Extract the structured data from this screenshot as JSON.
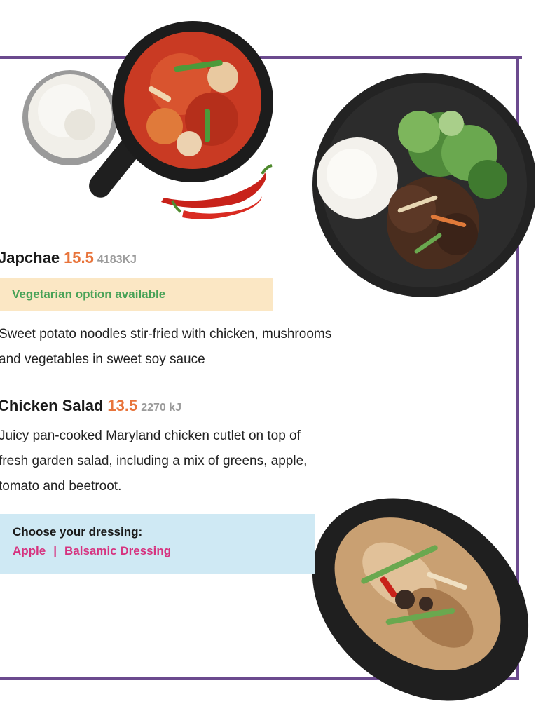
{
  "colors": {
    "frame": "#6b4a8e",
    "price": "#e8743b",
    "energy": "#9a9a9a",
    "veg_badge_bg": "#fbe7c4",
    "veg_text": "#48a257",
    "dressing_bg": "#cfe9f4",
    "dressing_option": "#d6337f"
  },
  "menu": {
    "japchae": {
      "name": "Japchae",
      "price": "15.5",
      "energy": "4183KJ",
      "badge": "Vegetarian option available",
      "description_lines": [
        "Sweet potato noodles stir-fried with chicken, mushrooms",
        "and vegetables in sweet soy sauce"
      ]
    },
    "chicken_salad": {
      "name": "Chicken Salad",
      "price": "13.5",
      "energy": "2270 kJ",
      "description_lines": [
        "Juicy pan-cooked Maryland chicken cutlet on top of",
        "fresh garden salad, including a mix of greens, apple,",
        "tomato and beetroot."
      ],
      "dressing": {
        "label": "Choose your dressing:",
        "options": [
          "Apple",
          "Balsamic Dressing"
        ],
        "separator": "|"
      }
    }
  }
}
